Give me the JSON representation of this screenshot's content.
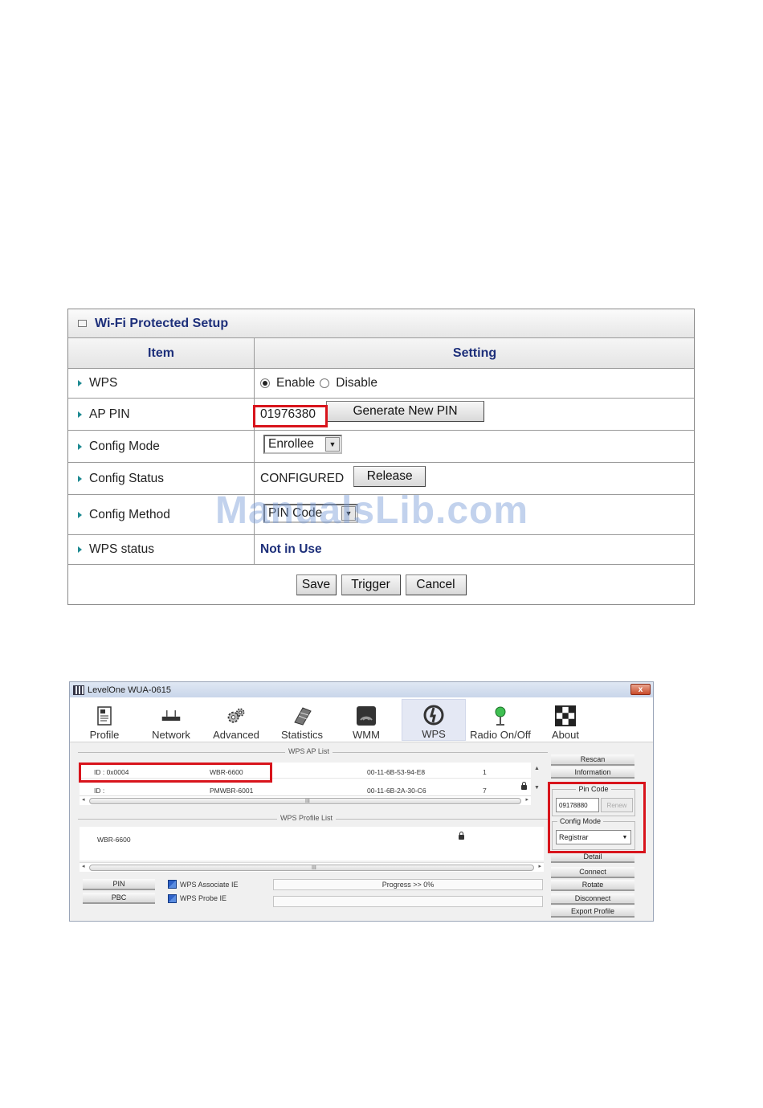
{
  "wps_panel": {
    "title": "Wi-Fi Protected Setup",
    "col_item": "Item",
    "col_setting": "Setting",
    "rows": {
      "wps": {
        "label": "WPS",
        "enable": "Enable",
        "disable": "Disable",
        "selected": "Enable"
      },
      "ap_pin": {
        "label": "AP PIN",
        "value": "01976380",
        "button": "Generate New PIN"
      },
      "config_mode": {
        "label": "Config Mode",
        "value": "Enrollee"
      },
      "config_status": {
        "label": "Config Status",
        "value": "CONFIGURED",
        "button": "Release"
      },
      "config_method": {
        "label": "Config Method",
        "value": "PIN Code"
      },
      "wps_status": {
        "label": "WPS status",
        "value": "Not in Use"
      }
    },
    "buttons": {
      "save": "Save",
      "trigger": "Trigger",
      "cancel": "Cancel"
    },
    "accent_color": "#1d2f7a",
    "highlight_color": "#d8141c"
  },
  "watermark": "ManualsLib.com",
  "utility": {
    "window_title": "LevelOne WUA-0615",
    "close_label": "x",
    "tabs": [
      "Profile",
      "Network",
      "Advanced",
      "Statistics",
      "WMM",
      "WPS",
      "Radio On/Off",
      "About"
    ],
    "active_tab": "WPS",
    "ap_list_title": "WPS AP List",
    "ap_list": [
      {
        "id": "ID : 0x0004",
        "ssid": "WBR-6600",
        "bssid": "00-11-6B-53-94-E8",
        "channel": "1"
      },
      {
        "id": "ID :",
        "ssid": "PMWBR-6001",
        "bssid": "00-11-6B-2A-30-C6",
        "channel": "7"
      }
    ],
    "profile_list_title": "WPS Profile List",
    "profile_list": [
      "WBR-6600"
    ],
    "pin_button": "PIN",
    "pbc_button": "PBC",
    "wps_associate_ie": "WPS Associate IE",
    "wps_probe_ie": "WPS Probe IE",
    "progress_text": "Progress >> 0%",
    "side_buttons": {
      "rescan": "Rescan",
      "information": "Information",
      "detail": "Detail",
      "connect": "Connect",
      "rotate": "Rotate",
      "disconnect": "Disconnect",
      "export_profile": "Export Profile"
    },
    "pin_code_legend": "Pin Code",
    "pin_code_value": "09178880",
    "renew_label": "Renew",
    "config_mode_legend": "Config Mode",
    "config_mode_value": "Registrar",
    "scroll_grip": "III"
  }
}
